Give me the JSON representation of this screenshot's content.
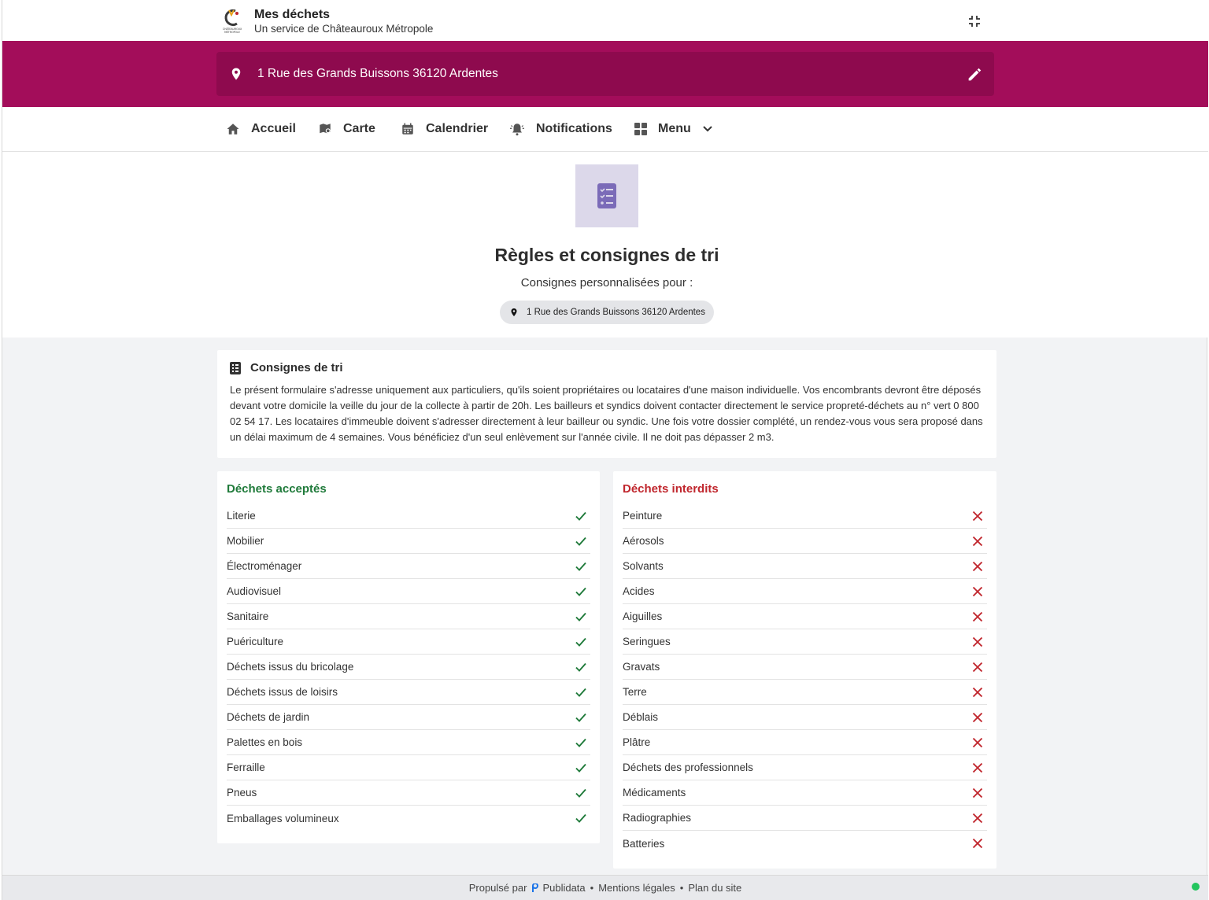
{
  "header": {
    "title": "Mes déchets",
    "subtitle": "Un service de Châteauroux Métropole",
    "logo_text": "CHÂTEAUROUX MÉTROPOLE"
  },
  "address": {
    "text": "1 Rue des Grands Buissons 36120 Ardentes"
  },
  "nav": {
    "items": [
      {
        "label": "Accueil",
        "icon": "home-icon"
      },
      {
        "label": "Carte",
        "icon": "map-icon"
      },
      {
        "label": "Calendrier",
        "icon": "calendar-icon"
      },
      {
        "label": "Notifications",
        "icon": "bell-icon"
      },
      {
        "label": "Menu",
        "icon": "grid-icon"
      }
    ]
  },
  "hero": {
    "title": "Règles et consignes de tri",
    "subtitle": "Consignes personnalisées pour :",
    "chip_address": "1 Rue des Grands Buissons 36120 Ardentes"
  },
  "info": {
    "title": "Consignes de tri",
    "text": "Le présent formulaire s'adresse uniquement aux particuliers, qu'ils soient propriétaires ou locataires d'une maison individuelle. Vos encombrants devront être déposés devant votre domicile la veille du jour de la collecte à partir de 20h. Les bailleurs et syndics doivent contacter directement le service propreté-déchets au n° vert 0 800 02 54 17. Les locataires d'immeuble doivent s'adresser directement à leur bailleur ou syndic. Une fois votre dossier complété, un rendez-vous vous sera proposé dans un délai maximum de 4 semaines. Vous bénéficiez d'un seul enlèvement sur l'année civile. Il ne doit pas dépasser 2 m3."
  },
  "accepted": {
    "title": "Déchets acceptés",
    "items": [
      "Literie",
      "Mobilier",
      "Électroménager",
      "Audiovisuel",
      "Sanitaire",
      "Puériculture",
      "Déchets issus du bricolage",
      "Déchets issus de loisirs",
      "Déchets de jardin",
      "Palettes en bois",
      "Ferraille",
      "Pneus",
      "Emballages volumineux"
    ]
  },
  "refused": {
    "title": "Déchets interdits",
    "items": [
      "Peinture",
      "Aérosols",
      "Solvants",
      "Acides",
      "Aiguilles",
      "Seringues",
      "Gravats",
      "Terre",
      "Déblais",
      "Plâtre",
      "Déchets des professionnels",
      "Médicaments",
      "Radiographies",
      "Batteries"
    ]
  },
  "footer": {
    "powered_by": "Propulsé par",
    "brand": "Publidata",
    "legal": "Mentions légales",
    "sitemap": "Plan du site",
    "separator": "•"
  },
  "colors": {
    "brand": "#a30d5a",
    "brand_dark": "#8e0a4e",
    "accepted": "#1f7a3a",
    "refused": "#c0262d",
    "hero_icon_bg": "#dcd8ea",
    "hero_icon": "#7b6bb8"
  }
}
